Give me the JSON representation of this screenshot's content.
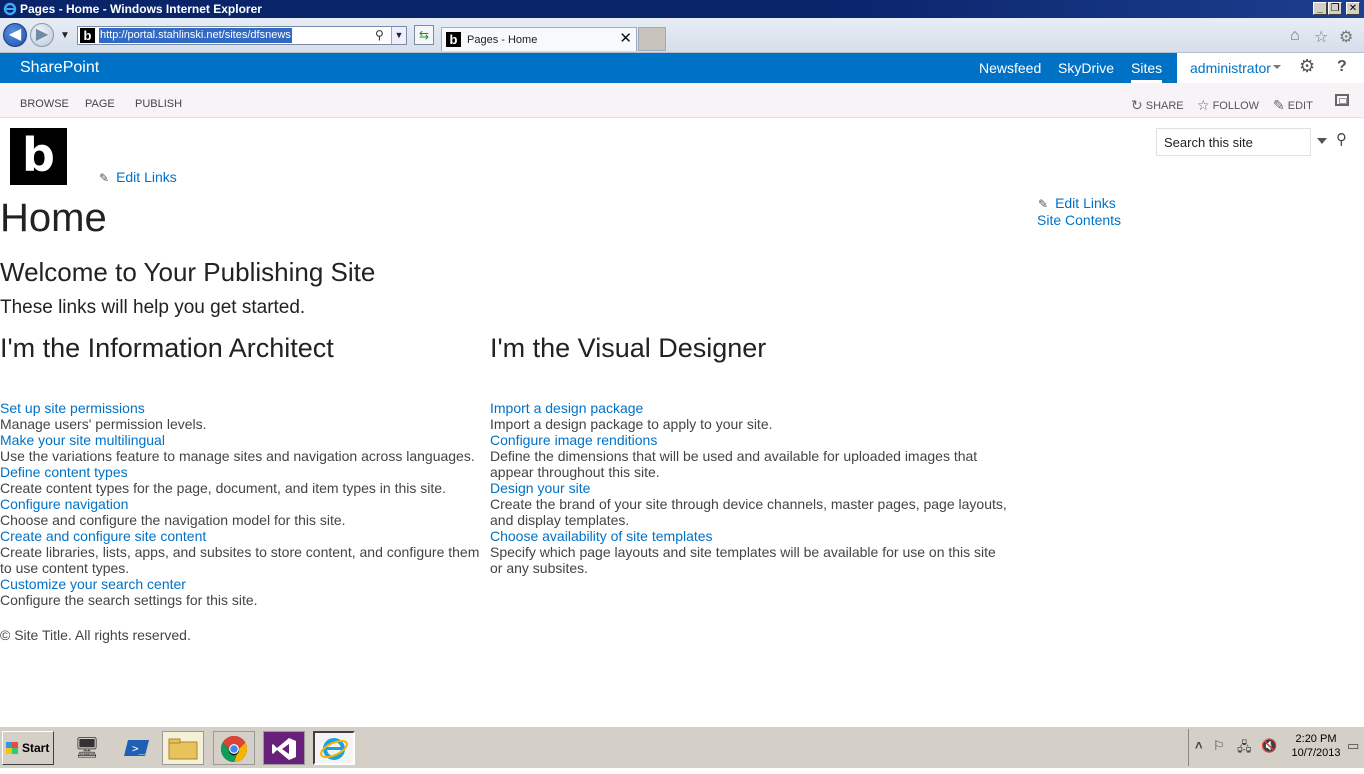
{
  "browser": {
    "window_title": "Pages - Home - Windows Internet Explorer",
    "url": "http://portal.stahlinski.net/sites/dfsnews",
    "tab_title": "Pages - Home",
    "favicon_letter": "b"
  },
  "suitebar": {
    "brand": "SharePoint",
    "links": [
      "Newsfeed",
      "SkyDrive",
      "Sites"
    ],
    "active_link": "Sites",
    "user": "administrator"
  },
  "ribbon": {
    "tabs": [
      "BROWSE",
      "PAGE",
      "PUBLISH"
    ],
    "actions": [
      "SHARE",
      "FOLLOW",
      "EDIT"
    ]
  },
  "header": {
    "logo_letter": "b",
    "edit_links": "Edit Links",
    "search_placeholder": "Search this site"
  },
  "quicklaunch": {
    "edit_links": "Edit Links",
    "site_contents": "Site Contents"
  },
  "page": {
    "title": "Home",
    "welcome": "Welcome to Your Publishing Site",
    "help_text": "These links will help you get started."
  },
  "columns": [
    {
      "heading": "I'm the Information Architect",
      "items": [
        {
          "link": "Set up site permissions",
          "desc": "Manage users' permission levels."
        },
        {
          "link": "Make your site multilingual",
          "desc": "Use the variations feature to manage sites and navigation across languages."
        },
        {
          "link": "Define content types",
          "desc": "Create content types for the page, document, and item types in this site."
        },
        {
          "link": "Configure navigation",
          "desc": "Choose and configure the navigation model for this site."
        },
        {
          "link": "Create and configure site content",
          "desc": "Create libraries, lists, apps, and subsites to store content, and configure them to use content types."
        },
        {
          "link": "Customize your search center",
          "desc": "Configure the search settings for this site."
        }
      ]
    },
    {
      "heading": "I'm the Visual Designer",
      "items": [
        {
          "link": "Import a design package",
          "desc": "Import a design package to apply to your site."
        },
        {
          "link": "Configure image renditions",
          "desc": "Define the dimensions that will be used and available for uploaded images that appear throughout this site."
        },
        {
          "link": "Design your site",
          "desc": "Create the brand of your site through device channels, master pages, page layouts, and display templates."
        },
        {
          "link": "Choose availability of site templates",
          "desc": "Specify which page layouts and site templates will be available for use on this site or any subsites."
        }
      ]
    }
  ],
  "footer": "© Site Title. All rights reserved.",
  "taskbar": {
    "start_label": "Start",
    "time": "2:20 PM",
    "date": "10/7/2013"
  },
  "colors": {
    "suitebar": "#0072c6",
    "link": "#0072c6",
    "titlebar": "#0a246a"
  }
}
